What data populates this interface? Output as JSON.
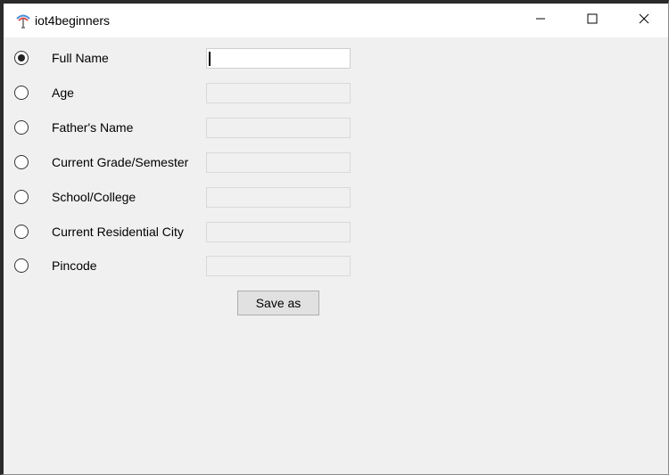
{
  "window": {
    "title": "iot4beginners",
    "app_icon": "feather-icon",
    "controls": {
      "minimize_icon": "minimize-icon",
      "maximize_icon": "maximize-icon",
      "close_icon": "close-icon"
    }
  },
  "form": {
    "fields": [
      {
        "label": "Full Name",
        "value": "",
        "selected": true,
        "active": true
      },
      {
        "label": "Age",
        "value": "",
        "selected": false,
        "active": false
      },
      {
        "label": "Father's Name",
        "value": "",
        "selected": false,
        "active": false
      },
      {
        "label": "Current Grade/Semester",
        "value": "",
        "selected": false,
        "active": false
      },
      {
        "label": "School/College",
        "value": "",
        "selected": false,
        "active": false
      },
      {
        "label": "Current Residential City",
        "value": "",
        "selected": false,
        "active": false
      },
      {
        "label": "Pincode",
        "value": "",
        "selected": false,
        "active": false
      }
    ],
    "save_label": "Save as"
  },
  "colors": {
    "background": "#f0f0f0",
    "titlebar": "#ffffff",
    "field_border": "#d9d9d9",
    "button_bg": "#e1e1e1"
  }
}
